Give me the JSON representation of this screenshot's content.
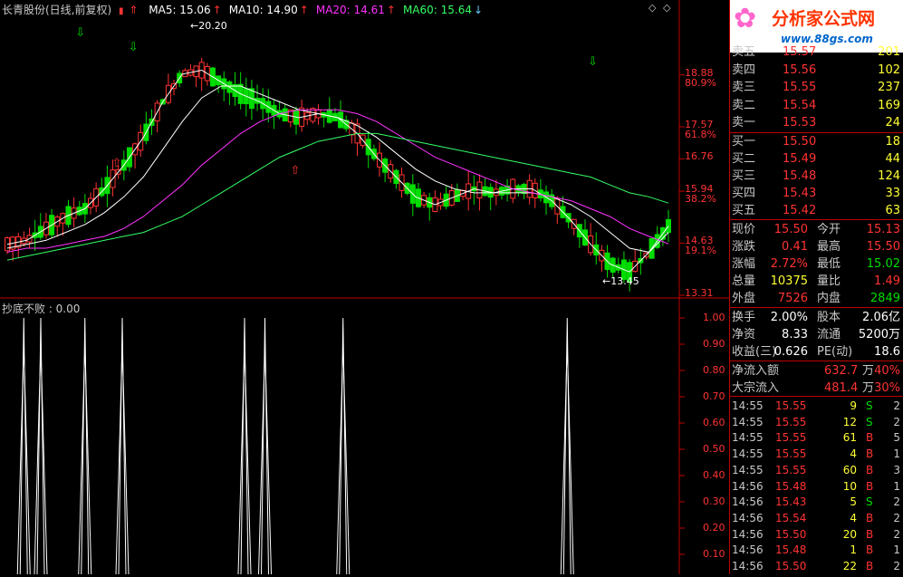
{
  "header": {
    "title": "长青股份(日线,前复权)",
    "ma": [
      {
        "label": "MA5: 15.06",
        "color": "#ffffff"
      },
      {
        "label": "MA10: 14.90",
        "color": "#ffffff"
      },
      {
        "label": "MA20: 14.61",
        "color": "#ff33ff"
      },
      {
        "label": "MA60: 15.64",
        "color": "#33ff66"
      }
    ]
  },
  "main_axis": {
    "ylim": [
      13.31,
      20.5
    ],
    "ticks": [
      {
        "price": "18.88",
        "pct": "80.9%",
        "y": 18.88
      },
      {
        "price": "17.57",
        "pct": "61.8%",
        "y": 17.57
      },
      {
        "price": "16.76",
        "pct": "",
        "y": 16.76
      },
      {
        "price": "15.94",
        "pct": "38.2%",
        "y": 15.94
      },
      {
        "price": "14.63",
        "pct": "19.1%",
        "y": 14.63
      },
      {
        "price": "13.31",
        "pct": "",
        "y": 13.31
      }
    ],
    "high_label": "20.20",
    "low_label": "13.45"
  },
  "indicator": {
    "title": "抄底不败 : 0.00",
    "ticks": [
      "1.00",
      "0.90",
      "0.80",
      "0.70",
      "0.60",
      "0.50",
      "0.40",
      "0.30",
      "0.20",
      "0.10"
    ]
  },
  "chart_data": {
    "type": "line",
    "title": "长青股份(日线,前复权)",
    "high": 20.2,
    "low": 13.45,
    "series": [
      {
        "name": "MA5",
        "values": [
          14.6,
          14.7,
          15.0,
          15.3,
          15.5,
          16.0,
          16.6,
          17.3,
          18.2,
          18.9,
          19.0,
          18.7,
          18.4,
          18.2,
          17.9,
          17.8,
          17.9,
          17.8,
          17.4,
          16.8,
          16.3,
          15.8,
          15.6,
          15.8,
          16.0,
          15.9,
          16.0,
          16.0,
          15.7,
          15.2,
          14.6,
          14.1,
          13.9,
          14.4,
          15.06
        ]
      },
      {
        "name": "MA10",
        "values": [
          14.5,
          14.6,
          14.7,
          14.9,
          15.1,
          15.4,
          15.8,
          16.3,
          17.0,
          17.7,
          18.3,
          18.6,
          18.6,
          18.4,
          18.2,
          18.0,
          17.9,
          17.8,
          17.6,
          17.3,
          16.9,
          16.5,
          16.2,
          16.0,
          15.9,
          15.9,
          15.9,
          15.9,
          15.8,
          15.6,
          15.3,
          14.9,
          14.5,
          14.4,
          14.9
        ]
      },
      {
        "name": "MA20",
        "values": [
          14.4,
          14.5,
          14.5,
          14.6,
          14.7,
          14.8,
          15.0,
          15.3,
          15.7,
          16.1,
          16.6,
          17.0,
          17.4,
          17.7,
          17.9,
          18.0,
          18.0,
          18.0,
          17.9,
          17.7,
          17.4,
          17.1,
          16.8,
          16.6,
          16.4,
          16.2,
          16.0,
          15.9,
          15.8,
          15.7,
          15.5,
          15.3,
          15.0,
          14.8,
          14.61
        ]
      },
      {
        "name": "MA60",
        "values": [
          14.2,
          14.3,
          14.4,
          14.5,
          14.6,
          14.7,
          14.8,
          14.9,
          15.1,
          15.3,
          15.6,
          15.9,
          16.2,
          16.5,
          16.8,
          17.0,
          17.2,
          17.3,
          17.4,
          17.4,
          17.3,
          17.2,
          17.1,
          17.0,
          16.9,
          16.8,
          16.7,
          16.6,
          16.5,
          16.4,
          16.3,
          16.1,
          15.9,
          15.8,
          15.64
        ]
      }
    ],
    "indicator_spikes": [
      0.035,
      0.06,
      0.125,
      0.18,
      0.36,
      0.39,
      0.505,
      0.835
    ]
  },
  "brand": {
    "name": "分析家公式网",
    "url": "www.88gs.com"
  },
  "quotes": {
    "sell": [
      {
        "label": "卖五",
        "price": "15.57",
        "vol": "201"
      },
      {
        "label": "卖四",
        "price": "15.56",
        "vol": "102"
      },
      {
        "label": "卖三",
        "price": "15.55",
        "vol": "237"
      },
      {
        "label": "卖二",
        "price": "15.54",
        "vol": "169"
      },
      {
        "label": "卖一",
        "price": "15.53",
        "vol": "24"
      }
    ],
    "buy": [
      {
        "label": "买一",
        "price": "15.50",
        "vol": "18"
      },
      {
        "label": "买二",
        "price": "15.49",
        "vol": "44"
      },
      {
        "label": "买三",
        "price": "15.48",
        "vol": "124"
      },
      {
        "label": "买四",
        "price": "15.43",
        "vol": "33"
      },
      {
        "label": "买五",
        "price": "15.42",
        "vol": "63"
      }
    ]
  },
  "stats": [
    {
      "l1": "现价",
      "v1": "15.50",
      "c1": "red",
      "l2": "今开",
      "v2": "15.13",
      "c2": "red"
    },
    {
      "l1": "涨跌",
      "v1": "0.41",
      "c1": "red",
      "l2": "最高",
      "v2": "15.50",
      "c2": "red"
    },
    {
      "l1": "涨幅",
      "v1": "2.72%",
      "c1": "red",
      "l2": "最低",
      "v2": "15.02",
      "c2": "green"
    },
    {
      "l1": "总量",
      "v1": "10375",
      "c1": "yellow",
      "l2": "量比",
      "v2": "1.49",
      "c2": "red"
    },
    {
      "l1": "外盘",
      "v1": "7526",
      "c1": "red",
      "l2": "内盘",
      "v2": "2849",
      "c2": "green"
    }
  ],
  "stats2": [
    {
      "l1": "换手",
      "v1": "2.00%",
      "l2": "股本",
      "v2": "2.06亿"
    },
    {
      "l1": "净资",
      "v1": "8.33",
      "l2": "流通",
      "v2": "5200万"
    },
    {
      "l1": "收益(三)",
      "v1": "0.626",
      "l2": "PE(动)",
      "v2": "18.6"
    }
  ],
  "flows": [
    {
      "label": "净流入额",
      "value": "632.7",
      "unit": "万",
      "pct": "40%"
    },
    {
      "label": "大宗流入",
      "value": "481.4",
      "unit": "万",
      "pct": "30%"
    }
  ],
  "ticks": [
    {
      "time": "14:55",
      "price": "15.55",
      "vol": "9",
      "side": "S",
      "n": "2"
    },
    {
      "time": "14:55",
      "price": "15.55",
      "vol": "12",
      "side": "S",
      "n": "2"
    },
    {
      "time": "14:55",
      "price": "15.55",
      "vol": "61",
      "side": "B",
      "n": "5"
    },
    {
      "time": "14:55",
      "price": "15.55",
      "vol": "4",
      "side": "B",
      "n": "1"
    },
    {
      "time": "14:55",
      "price": "15.55",
      "vol": "60",
      "side": "B",
      "n": "3"
    },
    {
      "time": "14:56",
      "price": "15.48",
      "vol": "10",
      "side": "B",
      "n": "1"
    },
    {
      "time": "14:56",
      "price": "15.43",
      "vol": "5",
      "side": "S",
      "n": "2"
    },
    {
      "time": "14:56",
      "price": "15.54",
      "vol": "4",
      "side": "B",
      "n": "2"
    },
    {
      "time": "14:56",
      "price": "15.50",
      "vol": "20",
      "side": "B",
      "n": "2"
    },
    {
      "time": "14:56",
      "price": "15.48",
      "vol": "1",
      "side": "B",
      "n": "1"
    },
    {
      "time": "14:56",
      "price": "15.50",
      "vol": "22",
      "side": "B",
      "n": "2"
    }
  ],
  "colors": {
    "up": "#ff3333",
    "down": "#00dd00",
    "border": "#c00000"
  }
}
